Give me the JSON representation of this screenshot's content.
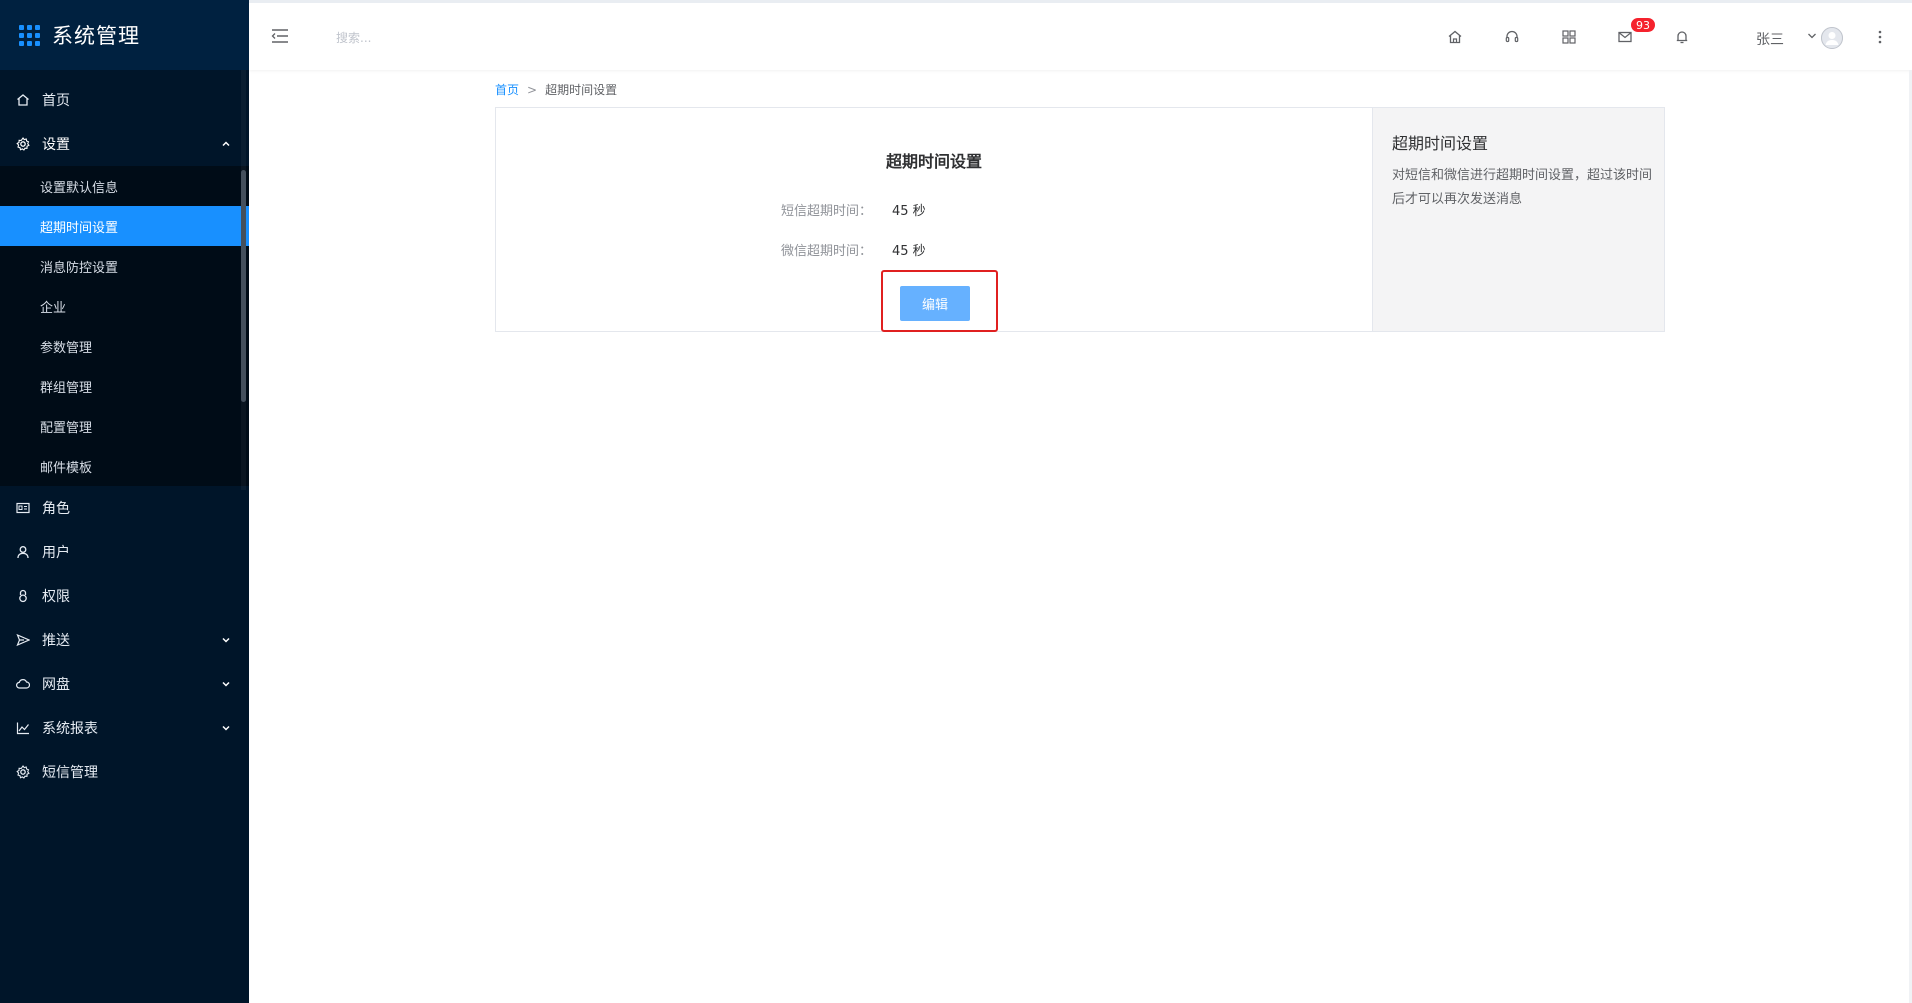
{
  "app": {
    "title": "系统管理"
  },
  "sidebar": {
    "items": [
      {
        "label": "首页",
        "icon": "home-icon"
      },
      {
        "label": "设置",
        "icon": "gear-icon",
        "expanded": true,
        "children": [
          {
            "label": "设置默认信息"
          },
          {
            "label": "超期时间设置",
            "active": true
          },
          {
            "label": "消息防控设置"
          },
          {
            "label": "企业"
          },
          {
            "label": "参数管理"
          },
          {
            "label": "群组管理"
          },
          {
            "label": "配置管理"
          },
          {
            "label": "邮件模板"
          }
        ]
      },
      {
        "label": "角色",
        "icon": "id-card-icon"
      },
      {
        "label": "用户",
        "icon": "user-icon"
      },
      {
        "label": "权限",
        "icon": "lock-icon"
      },
      {
        "label": "推送",
        "icon": "send-icon",
        "has_children": true
      },
      {
        "label": "网盘",
        "icon": "cloud-icon",
        "has_children": true
      },
      {
        "label": "系统报表",
        "icon": "chart-line-icon",
        "has_children": true
      },
      {
        "label": "短信管理",
        "icon": "gear-icon"
      }
    ]
  },
  "header": {
    "search_placeholder": "搜索...",
    "mail_badge": "93",
    "user_name": "张三"
  },
  "breadcrumb": {
    "home": "首页",
    "separator": ">",
    "current": "超期时间设置"
  },
  "main": {
    "title": "超期时间设置",
    "fields": [
      {
        "label": "短信超期时间：",
        "value": "45 秒"
      },
      {
        "label": "微信超期时间：",
        "value": "45 秒"
      }
    ],
    "edit_label": "编辑"
  },
  "info": {
    "title": "超期时间设置",
    "description": "对短信和微信进行超期时间设置，超过该时间后才可以再次发送消息"
  },
  "colors": {
    "sidebar_bg": "#001529",
    "submenu_bg": "#000c17",
    "accent": "#1890ff",
    "button": "#66b1ff",
    "badge": "#f5222d",
    "highlight_border": "#e02020"
  }
}
